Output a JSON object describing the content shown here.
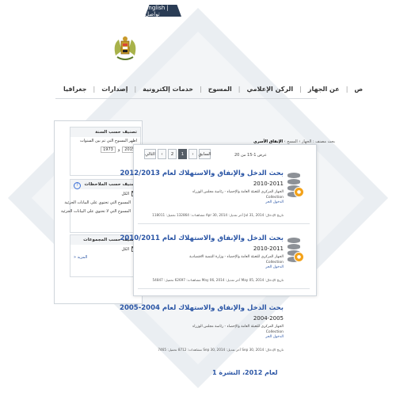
{
  "header": {
    "top_tab_label": "English | تواصل",
    "logo_icon": "emblem-logo"
  },
  "nav": {
    "items": [
      "جغرافيا",
      "إصدارات",
      "خدمات إلكترونية",
      "المسوح",
      "الركن الإعلامي",
      "عن الجهاز",
      "ص"
    ]
  },
  "breadcrumb": {
    "text": "بحث مصنف : ",
    "active": "الإنفاق الأسري",
    "items": [
      "الجهاز",
      "المسح",
      "الإنفاق الأسري"
    ]
  },
  "sidebar": {
    "year_filter": {
      "title": "تصنيف حسب السنة",
      "label": "اظهر المسوح التي تم بين السنوات",
      "from": "1973",
      "to": "2015",
      "joiner": "و"
    },
    "notes_filter": {
      "title": "تصنيف حسب الملاحظات",
      "all_label": "الكل",
      "options": [
        {
          "label": "المسوح التي تحتوي على البيانات الجزئية",
          "color": "#f3a21a"
        },
        {
          "label": "المسوح التي لا تحتوي على البيانات الجزئية",
          "color": "#d9534f"
        }
      ]
    },
    "collection_filter": {
      "title": "تصنيف حسب المجموعات",
      "all_label": "الكل",
      "more_label": "المزيد «"
    }
  },
  "pager": {
    "count_text": "عرض 1-15 من 20",
    "pages": [
      "التالي",
      "›",
      "2",
      "1",
      "‹",
      "السابق"
    ],
    "active_page": "1"
  },
  "results": [
    {
      "title": "بحث الدخل والإنفاق والاستهلاك لعام 2012/2013",
      "years": "2010-2011",
      "desc": "الجهاز المركزي للتعبئة العامة والإحصاء - رئاسة مجلس الوزراء",
      "collection": "Collection",
      "access": "الدخول الحر",
      "meta": "تاريخ الإدخال: Jul 31, 2014  آخر تعديل: Apr 30, 2014  مشاهدات: 132864  تحميل: 118011"
    },
    {
      "title": "بحث الدخل والإنفاق والاستهلاك لعام 2010/2011",
      "years": "2010-2011",
      "desc": "الجهاز المركزي للتعبئة العامة والإحصاء - وزارة التنمية الاقتصادية",
      "collection": "Collection",
      "access": "الدخول الحر",
      "meta": "تاريخ الإدخال: May 05, 2014  آخر تعديل: May 06, 2014  مشاهدات: 62697  تحميل: 54847"
    },
    {
      "title": "بحث الدخل والإنفاق والاستهلاك لعام 2004-2005",
      "years": "2004-2005",
      "desc": "الجهاز المركزي للتعبئة العامة والإحصاء - رئاسة مجلس الوزراء",
      "collection": "Collection",
      "access": "الدخول الحر",
      "meta": "تاريخ الإدخال: Sep 30, 2014  آخر تعديل: Sep 30, 2014  مشاهدات: 8712  تحميل: 7465"
    }
  ],
  "partial_result_title": "لعام 2012، النشرة 1"
}
